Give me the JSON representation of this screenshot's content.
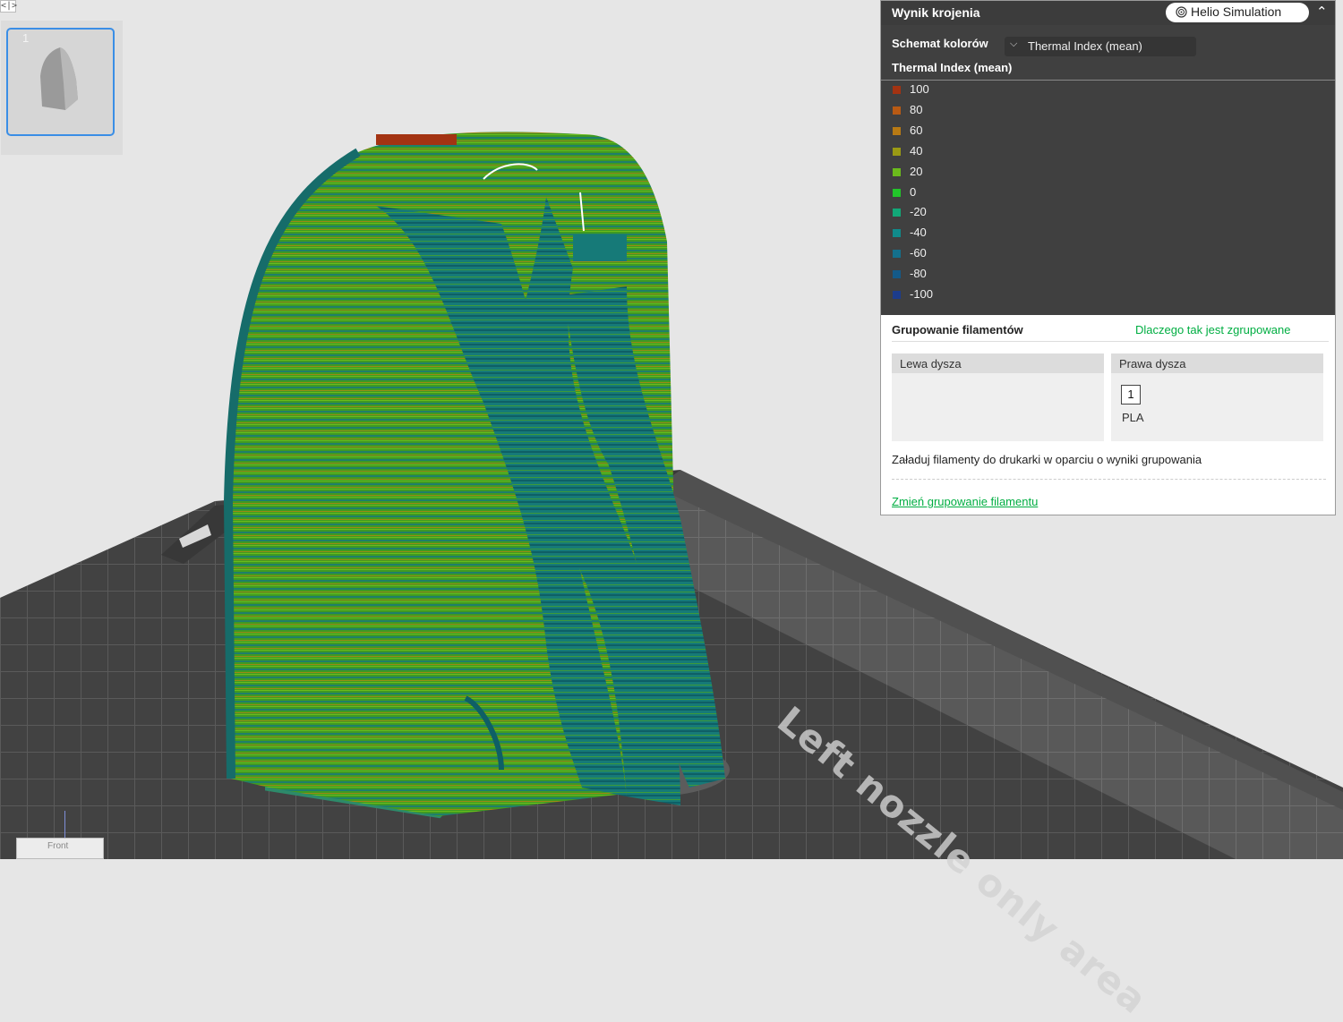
{
  "panel": {
    "title": "Wynik krojenia",
    "helio_button": "Helio Simulation",
    "color_scheme_label": "Schemat kolorów",
    "color_scheme_value": "Thermal Index (mean)",
    "legend_title": "Thermal Index (mean)",
    "legend": [
      {
        "label": "100",
        "color": "#a33312"
      },
      {
        "label": "80",
        "color": "#b85a14"
      },
      {
        "label": "60",
        "color": "#b87a14"
      },
      {
        "label": "40",
        "color": "#9a9a14"
      },
      {
        "label": "20",
        "color": "#6bbb1c"
      },
      {
        "label": "0",
        "color": "#22c52a"
      },
      {
        "label": "-20",
        "color": "#12a878"
      },
      {
        "label": "-40",
        "color": "#108a8a"
      },
      {
        "label": "-60",
        "color": "#14708c"
      },
      {
        "label": "-80",
        "color": "#145a88"
      },
      {
        "label": "-100",
        "color": "#1c3c8c"
      }
    ]
  },
  "grouping": {
    "title": "Grupowanie filamentów",
    "why_link": "Dlaczego tak jest zgrupowane",
    "left_nozzle": "Lewa dysza",
    "right_nozzle": "Prawa dysza",
    "filament_slot": "1",
    "filament_type": "PLA",
    "description": "Załaduj filamenty do drukarki w oparciu o wyniki grupowania",
    "change_link": "Zmień grupowanie filamentu"
  },
  "plate": {
    "number": "1"
  },
  "bed_overlay": "Left nozzle only area",
  "nav_cube_label": "Front",
  "colors": {
    "accent_green": "#00ae42",
    "selection_blue": "#3a8ee6",
    "panel_dark": "#404040"
  }
}
